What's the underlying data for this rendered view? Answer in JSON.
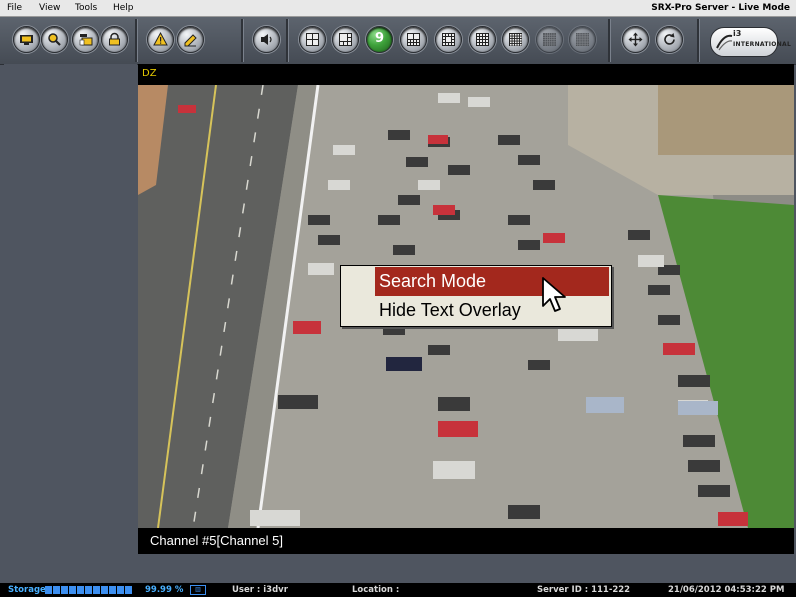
{
  "window": {
    "title": "SRX-Pro Server - Live Mode"
  },
  "menu": [
    "File",
    "View",
    "Tools",
    "Help"
  ],
  "toolbar": {
    "groups": [
      {
        "buttons": [
          {
            "name": "live-view-button",
            "icon": "monitor-icon"
          },
          {
            "name": "search-button",
            "icon": "magnifier-icon"
          },
          {
            "name": "backup-button",
            "icon": "archive-icon"
          },
          {
            "name": "lock-button",
            "icon": "lock-icon"
          }
        ]
      },
      {
        "buttons": [
          {
            "name": "alarm-button",
            "icon": "warning-icon"
          },
          {
            "name": "edit-button",
            "icon": "pencil-icon"
          }
        ]
      },
      {
        "buttons": [
          {
            "name": "audio-button",
            "icon": "speaker-icon"
          }
        ]
      },
      {
        "buttons": [
          {
            "name": "layout-4-button",
            "icon": "grid-2x2-icon"
          },
          {
            "name": "layout-6-button",
            "icon": "grid-6-icon"
          },
          {
            "name": "layout-9-button",
            "icon": "layout-number-icon",
            "label": "9",
            "active": true
          },
          {
            "name": "layout-10-button",
            "icon": "grid-10-icon"
          },
          {
            "name": "layout-13-button",
            "icon": "grid-13-icon"
          },
          {
            "name": "layout-16-button",
            "icon": "grid-16-icon"
          },
          {
            "name": "layout-25-button",
            "icon": "grid-25-icon"
          },
          {
            "name": "layout-36-button",
            "icon": "grid-36-icon",
            "disabled": true
          },
          {
            "name": "layout-64-button",
            "icon": "grid-64-icon",
            "disabled": true
          }
        ]
      },
      {
        "buttons": [
          {
            "name": "ptz-button",
            "icon": "move-arrows-icon"
          },
          {
            "name": "sequence-button",
            "icon": "refresh-icon"
          }
        ]
      }
    ],
    "logo": {
      "line1": "i3",
      "line2": "INTERNATIONAL"
    }
  },
  "channel": {
    "header_text": "DZ",
    "footer_text": "Channel #5[Channel 5]"
  },
  "context_menu": {
    "items": [
      {
        "label": "Search Mode",
        "highlighted": true
      },
      {
        "label": "Hide Text Overlay",
        "highlighted": false
      }
    ]
  },
  "status": {
    "storage_label": "Storage:",
    "storage_percent": "99.99 %",
    "storage_fill": 0.9999,
    "user": "User : i3dvr",
    "location": "Location :",
    "server_id": "Server ID : 111-222",
    "datetime": "21/06/2012  04:53:22 PM"
  },
  "colors": {
    "context_highlight": "#a3281d",
    "channel_header_text": "#e3c800",
    "storage_blue": "#3d8ff0",
    "layout_active": "#3ea23b"
  }
}
